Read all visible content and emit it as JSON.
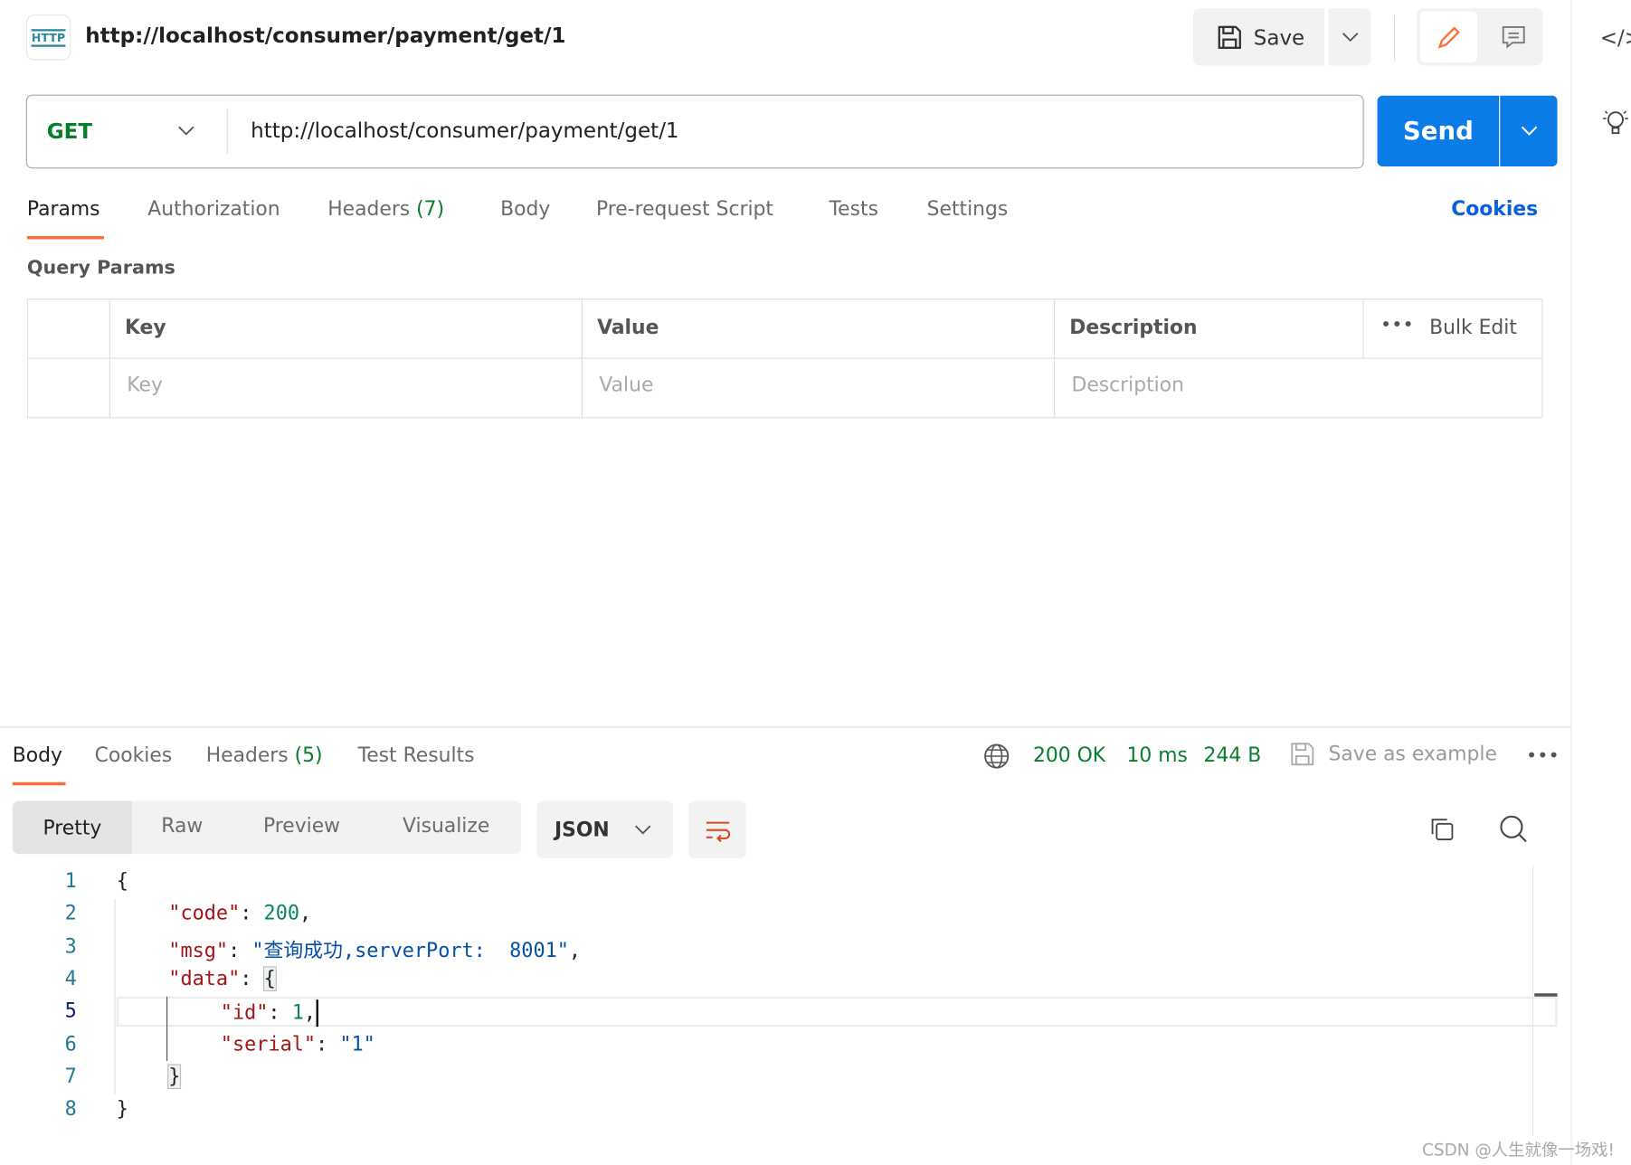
{
  "header": {
    "icon": "http-icon",
    "icon_text": "HTTP",
    "title": "http://localhost/consumer/payment/get/1",
    "save_label": "Save"
  },
  "request": {
    "method": "GET",
    "url": "http://localhost/consumer/payment/get/1",
    "send_label": "Send",
    "method_color": "#0a7d2c",
    "send_color": "#0b7be8"
  },
  "tabs": [
    {
      "label": "Params",
      "active": true
    },
    {
      "label": "Authorization"
    },
    {
      "label": "Headers",
      "count": "(7)"
    },
    {
      "label": "Body"
    },
    {
      "label": "Pre-request Script"
    },
    {
      "label": "Tests"
    },
    {
      "label": "Settings"
    }
  ],
  "cookies_label": "Cookies",
  "query_params": {
    "title": "Query Params",
    "columns": [
      "Key",
      "Value",
      "Description"
    ],
    "bulk_edit": "Bulk Edit",
    "placeholders": [
      "Key",
      "Value",
      "Description"
    ]
  },
  "response": {
    "tabs": [
      {
        "label": "Body",
        "active": true
      },
      {
        "label": "Cookies"
      },
      {
        "label": "Headers",
        "count": "(5)"
      },
      {
        "label": "Test Results"
      }
    ],
    "status": "200 OK",
    "time": "10 ms",
    "size": "244 B",
    "save_example": "Save as example",
    "views": [
      "Pretty",
      "Raw",
      "Preview",
      "Visualize"
    ],
    "active_view": "Pretty",
    "format": "JSON",
    "lines": [
      [
        {
          "t": "{",
          "c": "p"
        }
      ],
      [
        {
          "t": "\"code\"",
          "c": "k"
        },
        {
          "t": ": ",
          "c": "p"
        },
        {
          "t": "200",
          "c": "n"
        },
        {
          "t": ",",
          "c": "p"
        }
      ],
      [
        {
          "t": "\"msg\"",
          "c": "k"
        },
        {
          "t": ": ",
          "c": "p"
        },
        {
          "t": "\"查询成功,serverPort:  8001\"",
          "c": "s"
        },
        {
          "t": ",",
          "c": "p"
        }
      ],
      [
        {
          "t": "\"data\"",
          "c": "k"
        },
        {
          "t": ": ",
          "c": "p"
        },
        {
          "t": "{",
          "c": "b"
        }
      ],
      [
        {
          "t": "\"id\"",
          "c": "k"
        },
        {
          "t": ": ",
          "c": "p"
        },
        {
          "t": "1",
          "c": "n"
        },
        {
          "t": ",",
          "c": "p"
        }
      ],
      [
        {
          "t": "\"serial\"",
          "c": "k"
        },
        {
          "t": ": ",
          "c": "p"
        },
        {
          "t": "\"1\"",
          "c": "s"
        }
      ],
      [
        {
          "t": "}",
          "c": "b"
        }
      ],
      [
        {
          "t": "}",
          "c": "p"
        }
      ]
    ],
    "line_numbers": [
      "1",
      "2",
      "3",
      "4",
      "5",
      "6",
      "7",
      "8"
    ],
    "indents": [
      0,
      1,
      1,
      1,
      2,
      2,
      1,
      0
    ],
    "active_line": 5
  },
  "colors": {
    "accent": "#ff6c37",
    "status_green": "#0a7d2c",
    "link_blue": "#0b5ed7",
    "key": "#a31515",
    "number": "#098658",
    "string": "#0451a5",
    "line_number": "#237893"
  },
  "watermark": "CSDN @人生就像一场戏!"
}
